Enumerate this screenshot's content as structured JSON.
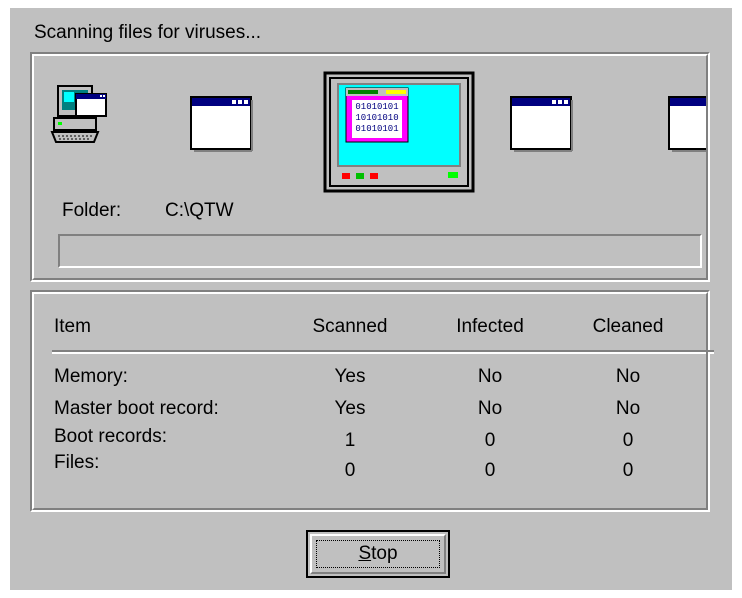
{
  "dialog": {
    "heading": "Scanning files for viruses...",
    "stop_label_accel": "S",
    "stop_label_rest": "top"
  },
  "scan": {
    "folder_label": "Folder:",
    "folder_value": "C:\\QTW",
    "progress": 0,
    "icons": [
      "computer-icon",
      "window-icon",
      "monitor-scanning-icon",
      "window-icon",
      "window-icon"
    ]
  },
  "results": {
    "headers": [
      "Item",
      "Scanned",
      "Infected",
      "Cleaned"
    ],
    "rows": [
      {
        "item": "Memory:",
        "scanned": "Yes",
        "infected": "No",
        "cleaned": "No"
      },
      {
        "item": "Master boot record:",
        "scanned": "Yes",
        "infected": "No",
        "cleaned": "No"
      },
      {
        "item": "Boot records:",
        "scanned": "1",
        "infected": "0",
        "cleaned": "0"
      },
      {
        "item": "Files:",
        "scanned": "0",
        "infected": "0",
        "cleaned": "0"
      }
    ]
  },
  "colors": {
    "face": "#c0c0c0",
    "shadow": "#808080",
    "highlight": "#ffffff",
    "title_blue": "#000080",
    "screen_cyan": "#00ffff",
    "magenta": "#ff00ff"
  }
}
